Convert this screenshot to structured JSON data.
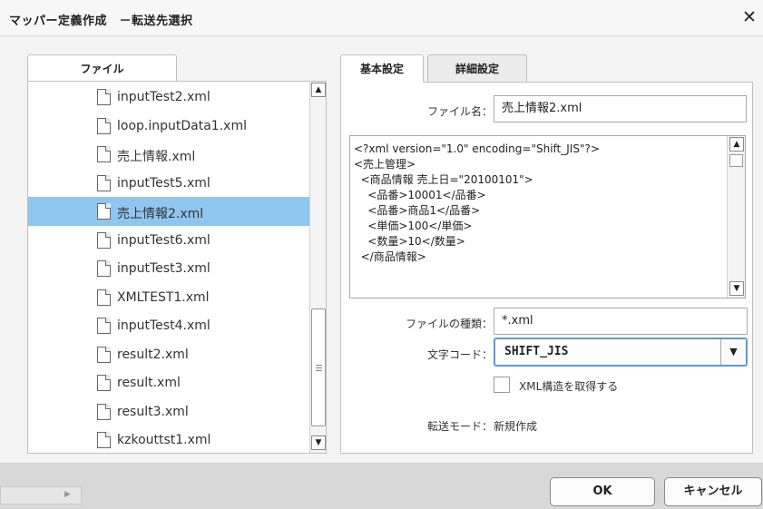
{
  "dialog": {
    "title": "マッパー定義作成　－転送先選択",
    "close_glyph": "✕"
  },
  "left": {
    "tab_label": "ファイル",
    "files": [
      {
        "name": "inputTest2.xml",
        "selected": false
      },
      {
        "name": "loop.inputData1.xml",
        "selected": false
      },
      {
        "name": "売上情報.xml",
        "selected": false
      },
      {
        "name": "inputTest5.xml",
        "selected": false
      },
      {
        "name": "売上情報2.xml",
        "selected": true
      },
      {
        "name": "inputTest6.xml",
        "selected": false
      },
      {
        "name": "inputTest3.xml",
        "selected": false
      },
      {
        "name": "XMLTEST1.xml",
        "selected": false
      },
      {
        "name": "inputTest4.xml",
        "selected": false
      },
      {
        "name": "result2.xml",
        "selected": false
      },
      {
        "name": "result.xml",
        "selected": false
      },
      {
        "name": "result3.xml",
        "selected": false
      },
      {
        "name": "kzkouttst1.xml",
        "selected": false
      }
    ],
    "scroll_up": "▲",
    "scroll_down": "▼"
  },
  "right": {
    "tabs": [
      {
        "label": "基本設定",
        "active": true
      },
      {
        "label": "詳細設定",
        "active": false
      }
    ],
    "filename_label": "ファイル名：",
    "filename_value": "売上情報2.xml",
    "preview_text": "<?xml version=\"1.0\" encoding=\"Shift_JIS\"?>\n<売上管理>\n  <商品情報 売上日=\"20100101\">\n    <品番>10001</品番>\n    <品番>商品1</品番>\n    <単価>100</単価>\n    <数量>10</数量>\n  </商品情報>",
    "filetype_label": "ファイルの種類：",
    "filetype_value": "*.xml",
    "charset_label": "文字コード：",
    "charset_value": "SHIFT_JIS",
    "checkbox_label": "XML構造を取得する",
    "checkbox_checked": false,
    "mode_label": "転送モード：",
    "mode_value": "新規作成"
  },
  "footer": {
    "ok_label": "OK",
    "cancel_label": "キャンセル"
  },
  "colors": {
    "selection": "#8fc6f0",
    "select_focus_border": "#5a9ad6"
  }
}
